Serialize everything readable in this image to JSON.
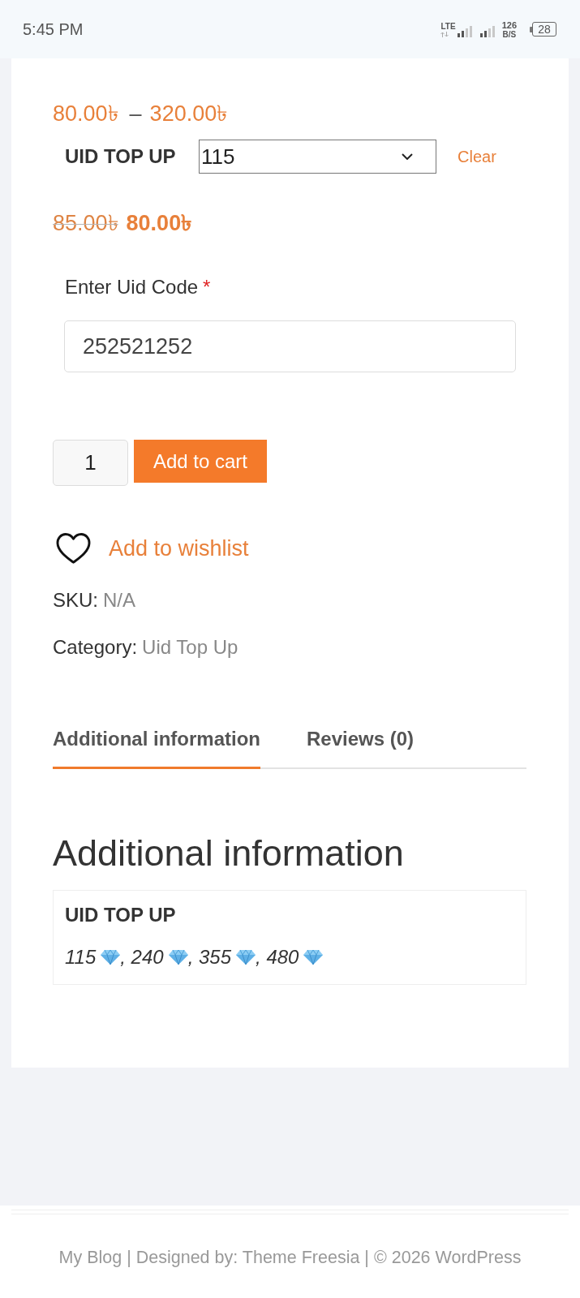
{
  "status_bar": {
    "time": "5:45 PM",
    "network": "LTE",
    "speed_value": "126",
    "speed_unit": "B/S",
    "battery": "28"
  },
  "product": {
    "price_range": {
      "from": "80.00৳",
      "separator": "–",
      "to": "320.00৳"
    },
    "variation": {
      "label": "UID TOP UP",
      "selected_value": "115",
      "clear": "Clear"
    },
    "price": {
      "regular": "85.00৳",
      "sale": "80.00৳"
    },
    "uid_field": {
      "label": "Enter Uid Code",
      "required_mark": "*",
      "value": "252521252"
    },
    "quantity": "1",
    "add_to_cart": "Add to cart",
    "wishlist": "Add to wishlist",
    "meta": [
      {
        "label": "SKU:",
        "value": "N/A"
      },
      {
        "label": "Category:",
        "value": "Uid Top Up"
      }
    ]
  },
  "tabs": [
    {
      "label": "Additional information",
      "selected": true
    },
    {
      "label": "Reviews (0)",
      "selected": false
    }
  ],
  "additional_info": {
    "heading": "Additional information",
    "attributes": [
      {
        "name": "UID TOP UP",
        "value_parts": [
          "115",
          ", 240",
          ", 355",
          ", 480"
        ]
      }
    ]
  },
  "footer": {
    "credits": "My Blog | Designed by: Theme Freesia | © 2026 WordPress"
  }
}
